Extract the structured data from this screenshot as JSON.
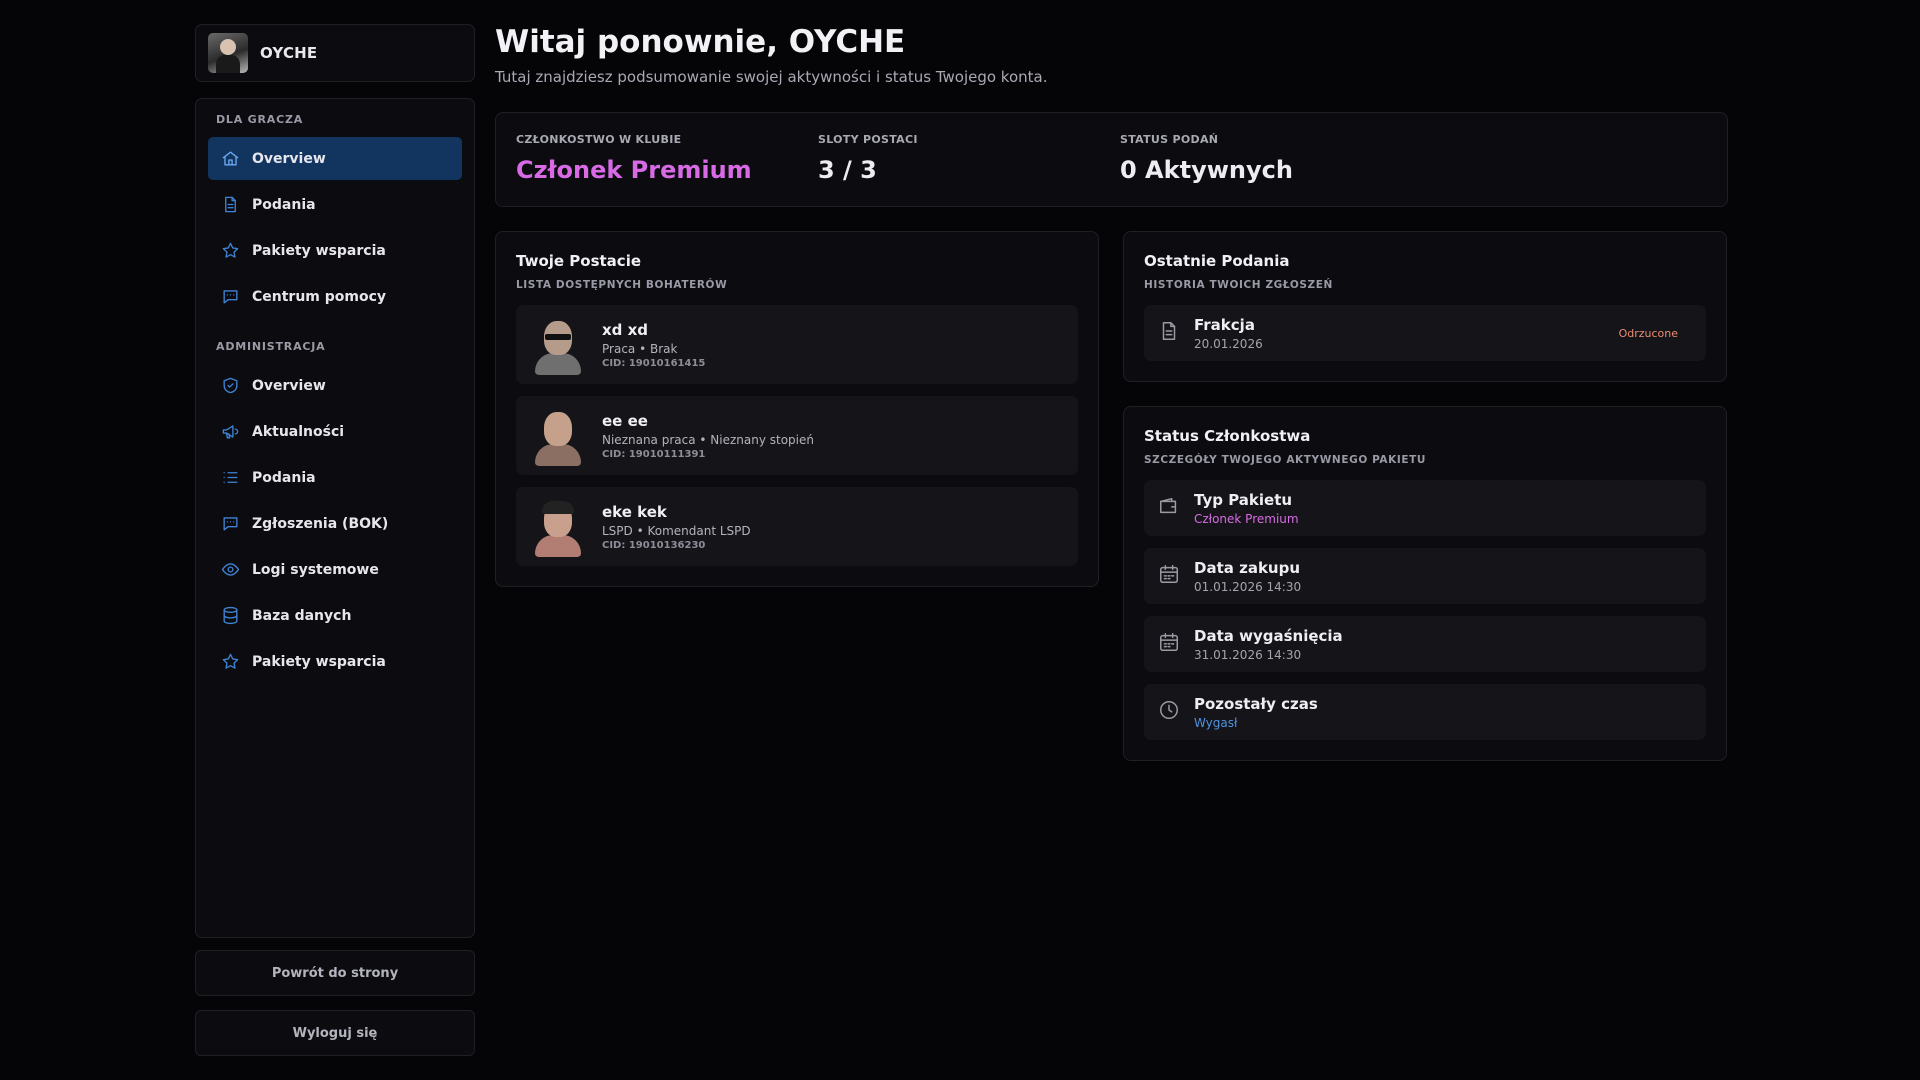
{
  "profile": {
    "name": "OYCHE"
  },
  "sidebar": {
    "player_section": "DLA GRACZA",
    "player_items": [
      {
        "label": "Overview",
        "icon": "home-icon"
      },
      {
        "label": "Podania",
        "icon": "document-icon"
      },
      {
        "label": "Pakiety wsparcia",
        "icon": "star-icon"
      },
      {
        "label": "Centrum pomocy",
        "icon": "chat-icon"
      }
    ],
    "admin_section": "ADMINISTRACJA",
    "admin_items": [
      {
        "label": "Overview",
        "icon": "shield-icon"
      },
      {
        "label": "Aktualności",
        "icon": "megaphone-icon"
      },
      {
        "label": "Podania",
        "icon": "list-icon"
      },
      {
        "label": "Zgłoszenia (BOK)",
        "icon": "chat-icon"
      },
      {
        "label": "Logi systemowe",
        "icon": "eye-icon"
      },
      {
        "label": "Baza danych",
        "icon": "database-icon"
      },
      {
        "label": "Pakiety wsparcia",
        "icon": "star-icon"
      }
    ],
    "back_label": "Powrót do strony",
    "logout_label": "Wyloguj się"
  },
  "header": {
    "title": "Witaj ponownie, OYCHE",
    "subtitle": "Tutaj znajdziesz podsumowanie swojej aktywności i status Twojego konta."
  },
  "stats": [
    {
      "label": "CZŁONKOSTWO W KLUBIE",
      "value": "Członek Premium"
    },
    {
      "label": "SLOTY POSTACI",
      "value": "3 / 3"
    },
    {
      "label": "STATUS PODAŃ",
      "value": "0 Aktywnych"
    }
  ],
  "characters": {
    "title": "Twoje Postacie",
    "subtitle": "LISTA DOSTĘPNYCH BOHATERÓW",
    "items": [
      {
        "name": "xd xd",
        "job": "Praca • Brak",
        "cid": "CID: 19010161415"
      },
      {
        "name": "ee ee",
        "job": "Nieznana praca • Nieznany stopień",
        "cid": "CID: 19010111391"
      },
      {
        "name": "eke kek",
        "job": "LSPD • Komendant LSPD",
        "cid": "CID: 19010136230"
      }
    ]
  },
  "applications": {
    "title": "Ostatnie Podania",
    "subtitle": "HISTORIA TWOICH ZGŁOSZEŃ",
    "items": [
      {
        "name": "Frakcja",
        "date": "20.01.2026",
        "status": "Odrzucone",
        "status_color": "#ed8b73"
      }
    ]
  },
  "membership": {
    "title": "Status Członkostwa",
    "subtitle": "SZCZEGÓŁY TWOJEGO AKTYWNEGO PAKIETU",
    "items": [
      {
        "label": "Typ Pakietu",
        "value": "Członek Premium",
        "icon": "wallet-icon"
      },
      {
        "label": "Data zakupu",
        "value": "01.01.2026 14:30",
        "icon": "calendar-icon"
      },
      {
        "label": "Data wygaśnięcia",
        "value": "31.01.2026 14:30",
        "icon": "calendar-icon"
      },
      {
        "label": "Pozostały czas",
        "value": "Wygasł",
        "icon": "clock-icon"
      }
    ]
  },
  "colors": {
    "accent_purple": "#d86ae6",
    "active_nav": "#123560",
    "icon_blue": "#3f83d4",
    "expired_blue": "#4f92e0"
  }
}
